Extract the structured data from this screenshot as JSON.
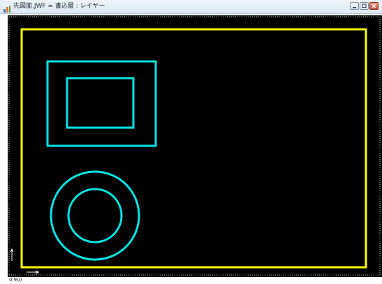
{
  "window": {
    "title": "先図面.JWF = 書込層 : レイヤー"
  },
  "canvas": {
    "background": "#000000",
    "frame_color": "#ffff00",
    "shape_color": "#00e5e5"
  },
  "status": {
    "text": "0.90)"
  },
  "icons": {
    "app": "app-icon",
    "minimize": "minimize-icon",
    "maximize": "maximize-icon",
    "close": "close-icon"
  }
}
